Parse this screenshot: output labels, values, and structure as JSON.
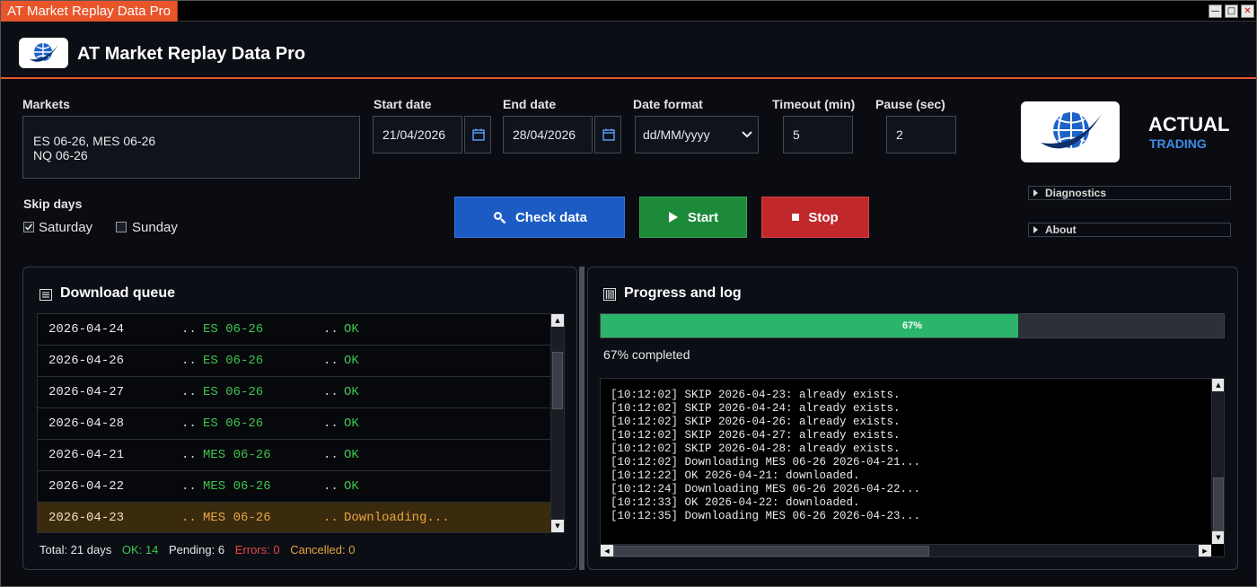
{
  "window": {
    "title": "AT Market Replay Data Pro",
    "controls": {
      "minimize": "—",
      "maximize": "□",
      "close": "✕"
    }
  },
  "header": {
    "title": "AT Market Replay Data Pro"
  },
  "form": {
    "markets_label": "Markets",
    "markets_line1": "ES 06-26, MES 06-26",
    "markets_line2": "NQ 06-26",
    "start_date_label": "Start date",
    "start_date": "21/04/2026",
    "end_date_label": "End date",
    "end_date": "28/04/2026",
    "date_format_label": "Date format",
    "date_format": "dd/MM/yyyy",
    "timeout_label": "Timeout (min)",
    "timeout": "5",
    "pause_label": "Pause (sec)",
    "pause": "2",
    "skip_days_label": "Skip days",
    "saturday_label": "Saturday",
    "saturday_checked": true,
    "sunday_label": "Sunday",
    "sunday_checked": false
  },
  "actions": {
    "check_label": "Check data",
    "start_label": "Start",
    "stop_label": "Stop"
  },
  "brand": {
    "main": "ACTUAL",
    "sub": "TRADING"
  },
  "expanders": {
    "diagnostics": "Diagnostics",
    "about": "About"
  },
  "queue": {
    "title": "Download queue",
    "rows": [
      {
        "date": "2026-04-24",
        "sep": "..",
        "market": "ES 06-26",
        "status": "OK"
      },
      {
        "date": "2026-04-26",
        "sep": "..",
        "market": "ES 06-26",
        "status": "OK"
      },
      {
        "date": "2026-04-27",
        "sep": "..",
        "market": "ES 06-26",
        "status": "OK"
      },
      {
        "date": "2026-04-28",
        "sep": "..",
        "market": "ES 06-26",
        "status": "OK"
      },
      {
        "date": "2026-04-21",
        "sep": "..",
        "market": "MES 06-26",
        "status": "OK"
      },
      {
        "date": "2026-04-22",
        "sep": "..",
        "market": "MES 06-26",
        "status": "OK"
      },
      {
        "date": "2026-04-23",
        "sep": "..",
        "market": "MES 06-26",
        "status": "Downloading..."
      }
    ],
    "stats": {
      "total": "Total: 21 days",
      "ok": "OK: 14",
      "pending": "Pending: 6",
      "errors": "Errors: 0",
      "cancelled": "Cancelled: 0"
    }
  },
  "progress": {
    "title": "Progress and log",
    "percent": 67,
    "bar_label": "67%",
    "text": "67% completed",
    "log": [
      "[10:12:02] SKIP 2026-04-23: already exists.",
      "[10:12:02] SKIP 2026-04-24: already exists.",
      "[10:12:02] SKIP 2026-04-26: already exists.",
      "[10:12:02] SKIP 2026-04-27: already exists.",
      "[10:12:02] SKIP 2026-04-28: already exists.",
      "[10:12:02] Downloading MES 06-26 2026-04-21...",
      "[10:12:22] OK 2026-04-21: downloaded.",
      "[10:12:24] Downloading MES 06-26 2026-04-22...",
      "[10:12:33] OK 2026-04-22: downloaded.",
      "[10:12:35] Downloading MES 06-26 2026-04-23..."
    ]
  },
  "colors": {
    "accent": "#e9552a",
    "ok": "#3ec44d",
    "pending": "#e8a640",
    "error": "#e84848",
    "progress": "#2bb56a"
  }
}
